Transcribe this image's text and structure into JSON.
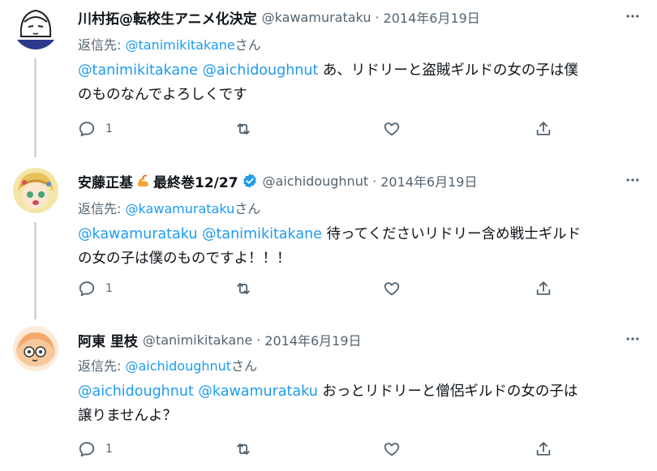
{
  "tweets": [
    {
      "name": "川村拓@転校生アニメ化決定",
      "handle": "@kawamurataku",
      "separator": "·",
      "date": "2014年6月19日",
      "reply_prefix": "返信先: ",
      "reply_to": "@tanimikitakane",
      "reply_suffix": "さん",
      "mention1": "@tanimikitakane",
      "mention2": "@aichidoughnut",
      "line1": "あ、リドリーと盗賊ギルドの女の子は僕",
      "line2": "のものなんでよろしくです",
      "reply_count": "1"
    },
    {
      "name": "安藤正基",
      "name_suffix": "最終巻12/27",
      "handle": "@aichidoughnut",
      "separator": "·",
      "date": "2014年6月19日",
      "reply_prefix": "返信先: ",
      "reply_to": "@kawamurataku",
      "reply_suffix": "さん",
      "mention1": "@kawamurataku",
      "mention2": "@tanimikitakane",
      "line1": "待ってくださいリドリー含め戦士ギルド",
      "line2": "の女の子は僕のものですよ！！！",
      "reply_count": "1"
    },
    {
      "name": "阿東 里枝",
      "handle": "@tanimikitakane",
      "separator": "·",
      "date": "2014年6月19日",
      "reply_prefix": "返信先: ",
      "reply_to": "@aichidoughnut",
      "reply_suffix": "さん",
      "mention1": "@aichidoughnut",
      "mention2": "@kawamurataku",
      "line1": "おっとリドリーと僧侶ギルドの女の子は",
      "line2": "譲りませんよ？",
      "reply_count": "1"
    }
  ],
  "icons": {
    "more": "more-dots-icon",
    "reply": "reply-bubble-icon",
    "retweet": "retweet-icon",
    "like": "heart-icon",
    "share": "share-icon",
    "verified": "verified-badge-icon",
    "emoji": "flexed-arm-emoji"
  },
  "colors": {
    "link": "#1d9bf0",
    "secondary_text": "#536471",
    "thread_line": "#cfd9de",
    "verified": "#1d9bf0"
  }
}
